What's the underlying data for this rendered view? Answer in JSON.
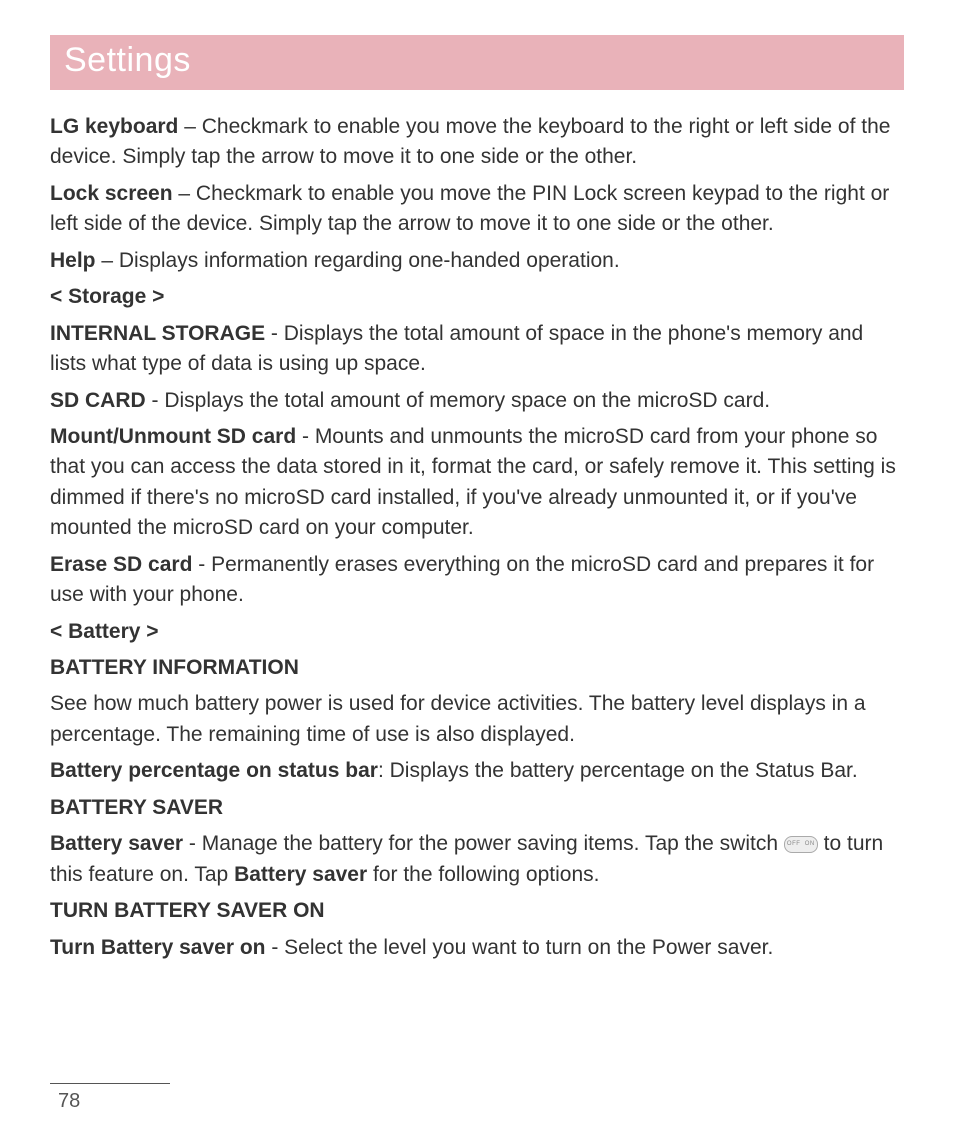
{
  "page_title": "Settings",
  "page_number": "78",
  "paragraphs": {
    "lg_keyboard_label": "LG keyboard",
    "lg_keyboard_text": " – Checkmark to enable you move the keyboard to the right or left side of the device. Simply tap the arrow to move it to one side or the other.",
    "lock_screen_label": "Lock screen",
    "lock_screen_text": " – Checkmark to enable you move the PIN Lock screen keypad to the right or left side of the device. Simply tap the arrow to move it to one side or the other.",
    "help_label": "Help",
    "help_text": " – Displays information regarding one-handed operation.",
    "storage_heading": "< Storage >",
    "internal_storage_label": "INTERNAL STORAGE",
    "internal_storage_text": " - Displays the total amount of space in the phone's memory and lists what type of data is using up space.",
    "sd_card_label": "SD CARD",
    "sd_card_text": " - Displays the total amount of memory space on the microSD card.",
    "mount_label": "Mount/Unmount SD card",
    "mount_text": " - Mounts and unmounts the microSD card from your phone so that you can access the data stored in it, format the card, or safely remove it. This setting is dimmed if there's no microSD card installed, if you've already unmounted it, or if you've mounted the microSD card on your computer.",
    "erase_label": "Erase SD card",
    "erase_text": " - Permanently erases everything on the microSD card and prepares it for use with your phone.",
    "battery_heading": "< Battery >",
    "battery_info_heading": "BATTERY INFORMATION",
    "battery_info_text": "See how much battery power is used for device activities. The battery level displays in a percentage. The remaining time of use is also displayed.",
    "battery_pct_label": "Battery percentage on status bar",
    "battery_pct_text": ": Displays the battery percentage on the Status Bar.",
    "battery_saver_heading": "BATTERY SAVER",
    "battery_saver_label": "Battery saver",
    "battery_saver_text1": " - Manage the battery for the power saving items. Tap the switch ",
    "battery_saver_text2": " to turn this feature on. Tap ",
    "battery_saver_bold2": "Battery saver",
    "battery_saver_text3": " for the following options.",
    "turn_on_heading": "TURN BATTERY SAVER ON",
    "turn_on_label": "Turn Battery saver on",
    "turn_on_text": " - Select the level you want to turn on the Power saver."
  }
}
